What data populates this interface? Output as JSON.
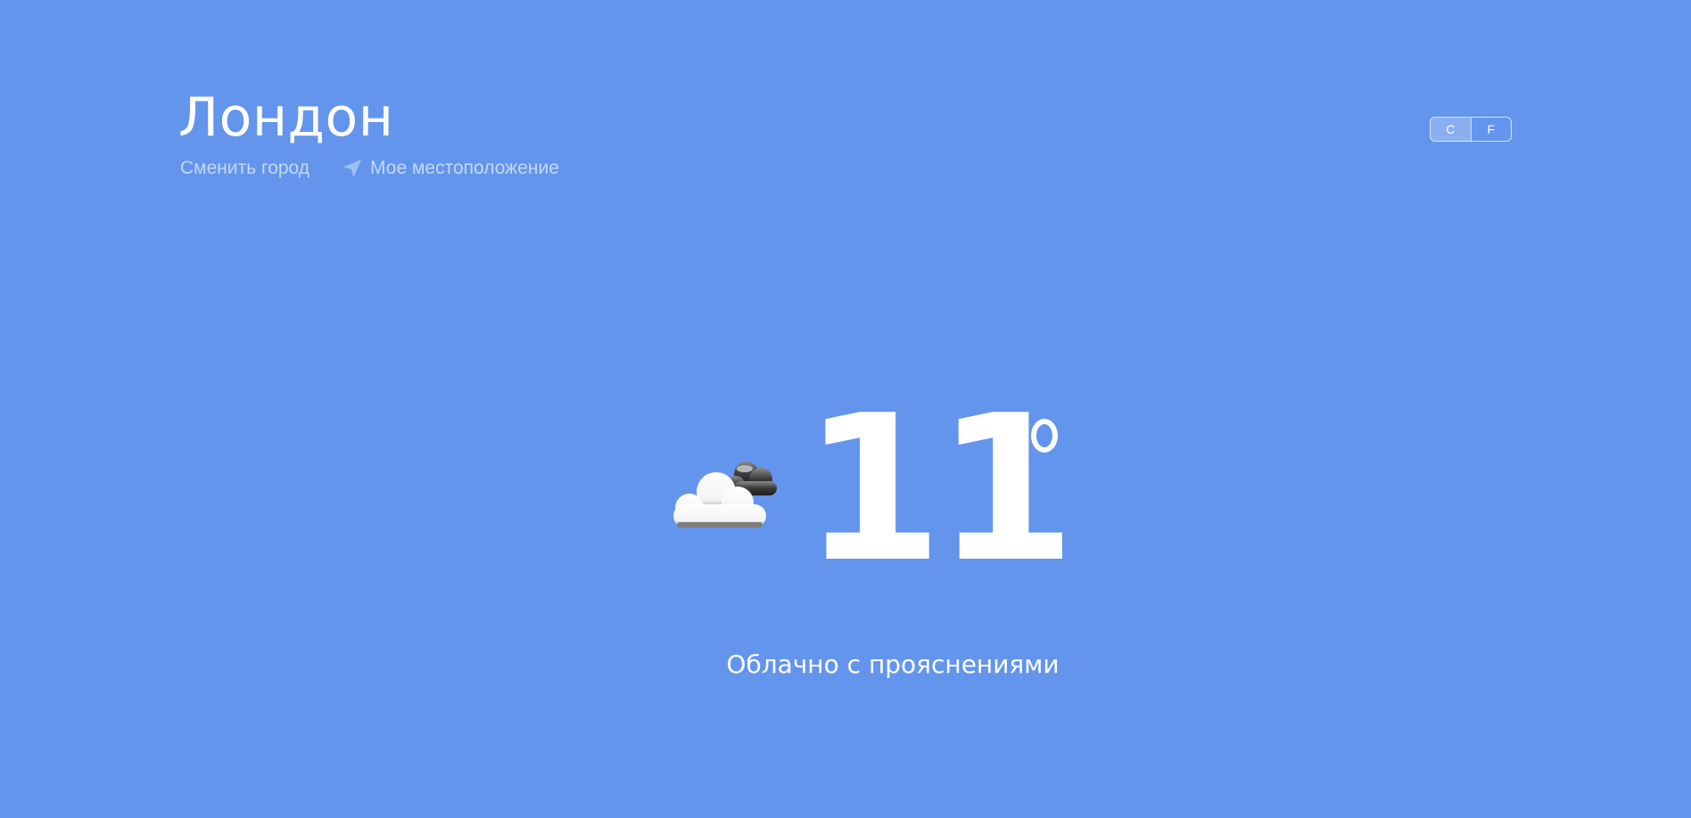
{
  "header": {
    "city": "Лондон",
    "change_city_label": "Сменить город",
    "my_location_label": "Мое местоположение",
    "location_icon": "navigation-arrow-icon"
  },
  "units": {
    "celsius_label": "C",
    "fahrenheit_label": "F",
    "selected": "C"
  },
  "current": {
    "icon": "partly-cloudy-icon",
    "temperature": "11",
    "condition": "Облачно с прояснениями"
  },
  "colors": {
    "background": "#6395ec",
    "text": "#ffffff"
  }
}
